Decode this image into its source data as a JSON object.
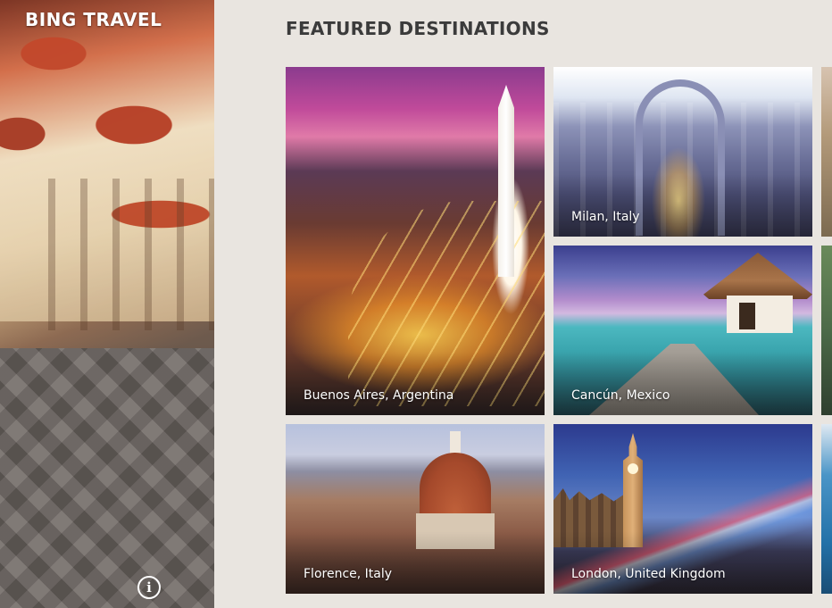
{
  "app": {
    "title": "BING TRAVEL"
  },
  "hero": {
    "info_icon_glyph": "i"
  },
  "main": {
    "section_title": "FEATURED DESTINATIONS",
    "destinations": [
      {
        "label": "Buenos Aires, Argentina"
      },
      {
        "label": "Milan, Italy"
      },
      {
        "label": "Cancún, Mexico"
      },
      {
        "label": "Florence, Italy"
      },
      {
        "label": "London, United Kingdom"
      }
    ]
  },
  "colors": {
    "background": "#e9e5e0",
    "section_title": "#3b3b3b",
    "caption_text": "#ffffff"
  }
}
